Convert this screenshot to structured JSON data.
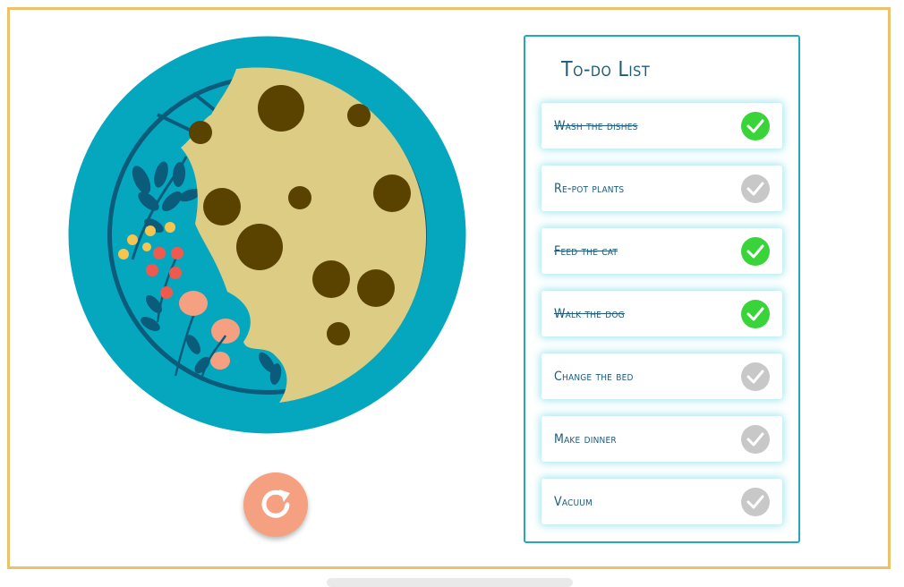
{
  "todo": {
    "title": "To-do List",
    "items": [
      {
        "label": "Wash the dishes",
        "done": true
      },
      {
        "label": "Re-pot plants",
        "done": false
      },
      {
        "label": "Feed the cat",
        "done": true
      },
      {
        "label": "Walk the dog",
        "done": true
      },
      {
        "label": "Change the bed",
        "done": false
      },
      {
        "label": "Make dinner",
        "done": false
      },
      {
        "label": "Vacuum",
        "done": false
      }
    ]
  },
  "icons": {
    "refresh": "refresh-icon",
    "check": "checkmark-icon"
  },
  "colors": {
    "frame": "#edc06b",
    "plate": "#05a7bf",
    "cookie": "#ddcc84",
    "chocolate_chip": "#5a4200",
    "refresh_button": "#f4a081",
    "panel_border": "#23a9b9",
    "text": "#1d5a7a",
    "check_done": "#39d43a",
    "check_pending": "#c8c8c8"
  }
}
